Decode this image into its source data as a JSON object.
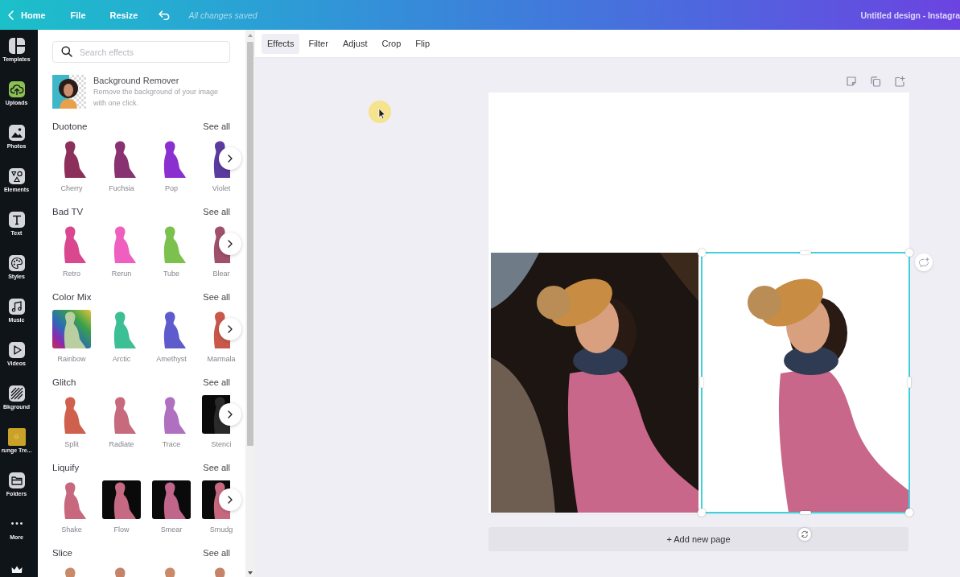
{
  "top_bar": {
    "home_label": "Home",
    "menu": [
      "File",
      "Resize"
    ],
    "save_status": "All changes saved",
    "document_title": "Untitled design - Instagra"
  },
  "sidebar": {
    "items": [
      {
        "label": "Templates",
        "kind": "icon"
      },
      {
        "label": "Uploads",
        "kind": "icon"
      },
      {
        "label": "Photos",
        "kind": "icon"
      },
      {
        "label": "Elements",
        "kind": "icon"
      },
      {
        "label": "Text",
        "kind": "icon"
      },
      {
        "label": "Styles",
        "kind": "icon"
      },
      {
        "label": "Music",
        "kind": "icon"
      },
      {
        "label": "Videos",
        "kind": "icon"
      },
      {
        "label": "Bkground",
        "kind": "icon"
      },
      {
        "label": "runge Tre...",
        "kind": "tile",
        "tile_text": "G"
      },
      {
        "label": "Folders",
        "kind": "icon"
      },
      {
        "label": "More",
        "kind": "icon"
      }
    ]
  },
  "panel": {
    "search": {
      "placeholder": "Search effects"
    },
    "feature": {
      "title": "Background Remover",
      "description": "Remove the background of your image with one click."
    },
    "sections": [
      {
        "title": "Duotone",
        "see_all": "See all",
        "scroll_button": true,
        "items": [
          {
            "label": "Cherry",
            "kind": "cutout",
            "color": "#8c2f5a"
          },
          {
            "label": "Fuchsia",
            "kind": "cutout",
            "color": "#883272"
          },
          {
            "label": "Pop",
            "kind": "cutout",
            "color": "#8a2fd0"
          },
          {
            "label": "Violet",
            "kind": "cutout",
            "color": "#5b3b9e"
          }
        ]
      },
      {
        "title": "Bad TV",
        "see_all": "See all",
        "scroll_button": true,
        "items": [
          {
            "label": "Retro",
            "kind": "cutout",
            "color": "#d9488f"
          },
          {
            "label": "Rerun",
            "kind": "cutout",
            "color": "#ee5fc0"
          },
          {
            "label": "Tube",
            "kind": "cutout",
            "color": "#7cc04e"
          },
          {
            "label": "Blear",
            "kind": "cutout",
            "color": "#a0506a"
          }
        ]
      },
      {
        "title": "Color Mix",
        "see_all": "See all",
        "scroll_button": true,
        "items": [
          {
            "label": "Rainbow",
            "kind": "gradient-tile",
            "color": "#b9cfa2"
          },
          {
            "label": "Arctic",
            "kind": "cutout",
            "color": "#3cbf95"
          },
          {
            "label": "Amethyst",
            "kind": "cutout",
            "color": "#5e5ccc"
          },
          {
            "label": "Marmala",
            "kind": "cutout",
            "color": "#c9584a"
          }
        ]
      },
      {
        "title": "Glitch",
        "see_all": "See all",
        "scroll_button": true,
        "items": [
          {
            "label": "Split",
            "kind": "cutout",
            "color": "#d0604e"
          },
          {
            "label": "Radiate",
            "kind": "cutout",
            "color": "#c86a7e"
          },
          {
            "label": "Trace",
            "kind": "cutout",
            "color": "#b070c0"
          },
          {
            "label": "Stenci",
            "kind": "dark-tile",
            "color": "#2a2a2a"
          }
        ]
      },
      {
        "title": "Liquify",
        "see_all": "See all",
        "scroll_button": true,
        "items": [
          {
            "label": "Shake",
            "kind": "cutout",
            "color": "#c8687e"
          },
          {
            "label": "Flow",
            "kind": "dark-tile",
            "color": "#c66a84"
          },
          {
            "label": "Smear",
            "kind": "dark-tile",
            "color": "#c0668a"
          },
          {
            "label": "Smudg",
            "kind": "dark-tile",
            "color": "#c8687e"
          }
        ]
      },
      {
        "title": "Slice",
        "see_all": "See all",
        "scroll_button": false,
        "items": [
          {
            "kind": "cutout",
            "color": "#c98a6a"
          },
          {
            "kind": "cutout",
            "color": "#c4846a"
          },
          {
            "kind": "cutout",
            "color": "#c98a6a"
          },
          {
            "kind": "cutout",
            "color": "#c4846a"
          }
        ]
      }
    ]
  },
  "editor": {
    "tabs": [
      {
        "label": "Effects",
        "selected": true
      },
      {
        "label": "Filter",
        "selected": false
      },
      {
        "label": "Adjust",
        "selected": false
      },
      {
        "label": "Crop",
        "selected": false
      },
      {
        "label": "Flip",
        "selected": false
      }
    ],
    "images": [
      {
        "kind": "photo",
        "selected": false
      },
      {
        "kind": "cutout",
        "selected": true
      }
    ],
    "add_page_label": "+ Add new page"
  }
}
